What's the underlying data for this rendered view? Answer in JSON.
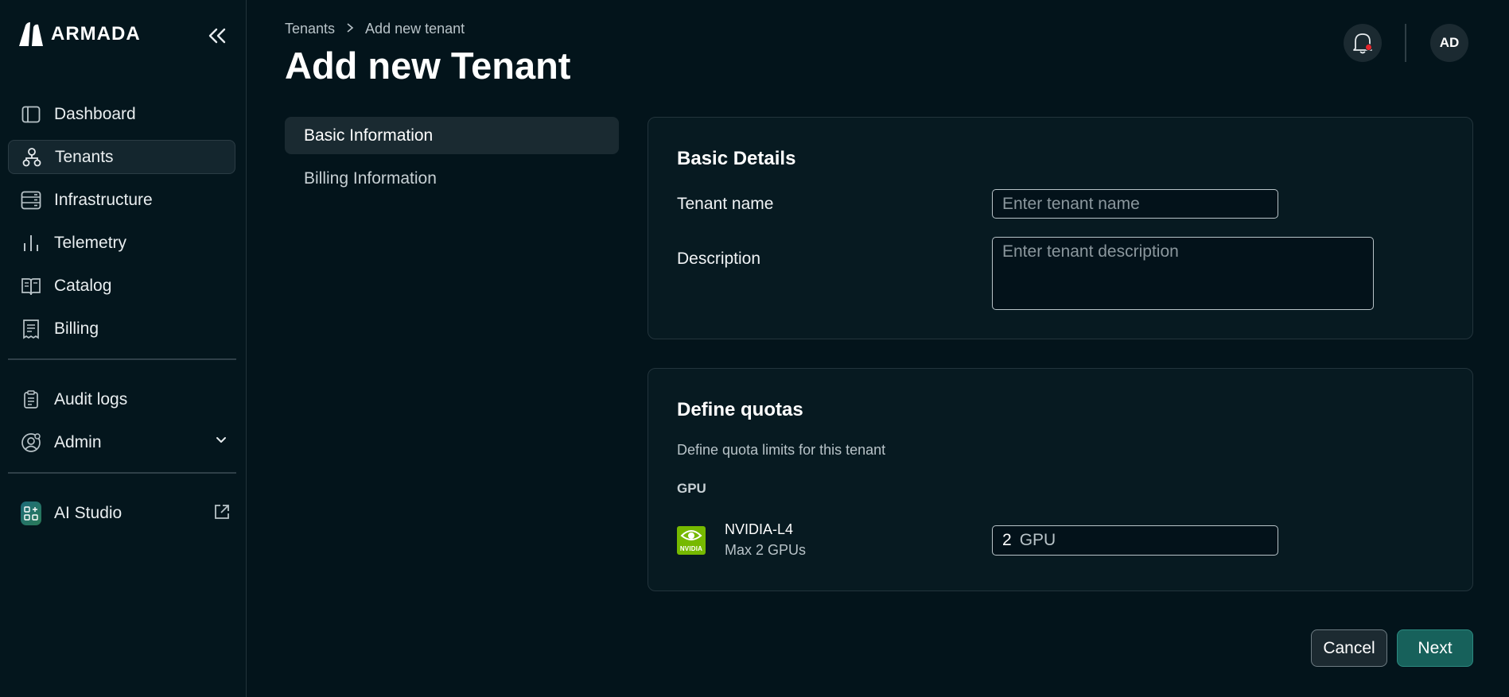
{
  "app": {
    "brand": "ARMADA"
  },
  "sidebar": {
    "items": [
      {
        "label": "Dashboard",
        "icon": "dashboard-icon",
        "active": false
      },
      {
        "label": "Tenants",
        "icon": "tenants-icon",
        "active": true
      },
      {
        "label": "Infrastructure",
        "icon": "infrastructure-icon",
        "active": false
      },
      {
        "label": "Telemetry",
        "icon": "telemetry-icon",
        "active": false
      },
      {
        "label": "Catalog",
        "icon": "catalog-icon",
        "active": false
      },
      {
        "label": "Billing",
        "icon": "billing-icon",
        "active": false
      }
    ],
    "secondary": [
      {
        "label": "Audit logs",
        "icon": "audit-logs-icon"
      },
      {
        "label": "Admin",
        "icon": "admin-icon"
      }
    ],
    "studio": {
      "label": "AI Studio",
      "icon": "ai-studio-icon"
    }
  },
  "header": {
    "breadcrumb": [
      "Tenants",
      "Add new tenant"
    ],
    "title": "Add new Tenant",
    "avatar_initials": "AD",
    "notification_dot_color": "#e5262d"
  },
  "steps": [
    {
      "label": "Basic Information",
      "active": true
    },
    {
      "label": "Billing Information",
      "active": false
    }
  ],
  "basic_details": {
    "title": "Basic Details",
    "tenant_name_label": "Tenant name",
    "tenant_name_placeholder": "Enter tenant name",
    "tenant_name_value": "",
    "description_label": "Description",
    "description_placeholder": "Enter tenant description",
    "description_value": ""
  },
  "quotas": {
    "title": "Define quotas",
    "subtitle": "Define quota limits for this tenant",
    "gpu_heading": "GPU",
    "gpus": [
      {
        "logo_text": "NVIDIA",
        "name": "NVIDIA-L4",
        "max": "Max 2 GPUs",
        "value": "2",
        "unit": "GPU"
      }
    ]
  },
  "footer": {
    "cancel_label": "Cancel",
    "next_label": "Next"
  },
  "colors": {
    "accent": "#17615b",
    "nvidia_green": "#76b900",
    "background": "#03141b"
  }
}
